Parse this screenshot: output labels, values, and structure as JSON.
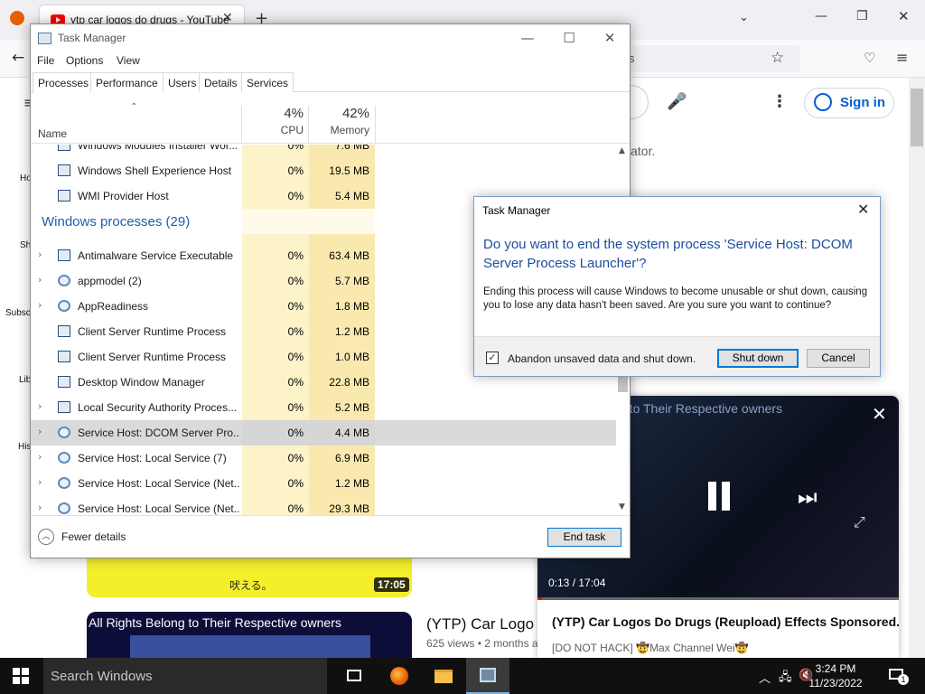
{
  "browser": {
    "tab_title": "ytp car logos do drugs - YouTube",
    "tab_close": "✕",
    "new_tab": "+",
    "url_fragment": "s",
    "page": {
      "sign_in": "Sign in",
      "partial_text": "ator.",
      "sidebar": [
        "Ho",
        "Sh",
        "Subsc",
        "Lib",
        "His"
      ]
    },
    "thumb1": {
      "caption": "吠える。",
      "duration": "17:05"
    },
    "thumb2": {
      "caption": "All Rights Belong to Their Respective owners"
    },
    "video": {
      "title": "(YTP) Car Logo",
      "meta": "625 views • 2 months a"
    },
    "miniplayer": {
      "overlay_text": "g to Their Respective owners",
      "time": "0:13 / 17:04",
      "progress": 0.013,
      "title": "(YTP) Car Logos Do Drugs (Reupload) Effects Sponsored...",
      "channel": "[DO NOT HACK] 🤠Max Channel Wei🤠"
    }
  },
  "task_manager": {
    "title": "Task Manager",
    "menu": [
      "File",
      "Options",
      "View"
    ],
    "tabs": [
      "Processes",
      "Performance",
      "Users",
      "Details",
      "Services"
    ],
    "active_tab": "Processes",
    "columns": {
      "name": "Name",
      "cpu_pct": "4%",
      "cpu_label": "CPU",
      "mem_pct": "42%",
      "mem_label": "Memory"
    },
    "rows": [
      {
        "name": "Windows Modules Installer Wor...",
        "cpu": "0%",
        "mem": "7.6 MB",
        "expand": false,
        "icon": "window"
      },
      {
        "name": "Windows Shell Experience Host",
        "cpu": "0%",
        "mem": "19.5 MB",
        "expand": false,
        "icon": "window"
      },
      {
        "name": "WMI Provider Host",
        "cpu": "0%",
        "mem": "5.4 MB",
        "expand": false,
        "icon": "window"
      }
    ],
    "group": "Windows processes (29)",
    "group_rows": [
      {
        "name": "Antimalware Service Executable",
        "cpu": "0%",
        "mem": "63.4 MB",
        "expand": true,
        "icon": "window"
      },
      {
        "name": "appmodel (2)",
        "cpu": "0%",
        "mem": "5.7 MB",
        "expand": true,
        "icon": "gear"
      },
      {
        "name": "AppReadiness",
        "cpu": "0%",
        "mem": "1.8 MB",
        "expand": true,
        "icon": "gear"
      },
      {
        "name": "Client Server Runtime Process",
        "cpu": "0%",
        "mem": "1.2 MB",
        "expand": false,
        "icon": "window"
      },
      {
        "name": "Client Server Runtime Process",
        "cpu": "0%",
        "mem": "1.0 MB",
        "expand": false,
        "icon": "window"
      },
      {
        "name": "Desktop Window Manager",
        "cpu": "0%",
        "mem": "22.8 MB",
        "expand": false,
        "icon": "window"
      },
      {
        "name": "Local Security Authority Proces...",
        "cpu": "0%",
        "mem": "5.2 MB",
        "expand": true,
        "icon": "window"
      },
      {
        "name": "Service Host: DCOM Server Pro...",
        "cpu": "0%",
        "mem": "4.4 MB",
        "expand": true,
        "icon": "gear",
        "selected": true
      },
      {
        "name": "Service Host: Local Service (7)",
        "cpu": "0%",
        "mem": "6.9 MB",
        "expand": true,
        "icon": "gear"
      },
      {
        "name": "Service Host: Local Service (Net...",
        "cpu": "0%",
        "mem": "1.2 MB",
        "expand": true,
        "icon": "gear"
      },
      {
        "name": "Service Host: Local Service (Net...",
        "cpu": "0%",
        "mem": "29.3 MB",
        "expand": true,
        "icon": "gear"
      }
    ],
    "fewer_details": "Fewer details",
    "end_task": "End task"
  },
  "dialog": {
    "title": "Task Manager",
    "close": "✕",
    "question": "Do you want to end the system process 'Service Host: DCOM Server Process Launcher'?",
    "message": "Ending this process will cause Windows to become unusable or shut down, causing you to lose any data hasn't been saved. Are you sure you want to continue?",
    "checkbox_label": "Abandon unsaved data and shut down.",
    "checkbox_checked": true,
    "shutdown": "Shut down",
    "cancel": "Cancel"
  },
  "taskbar": {
    "search_placeholder": "Search Windows",
    "time": "3:24 PM",
    "date": "11/23/2022",
    "notification_count": "1"
  }
}
